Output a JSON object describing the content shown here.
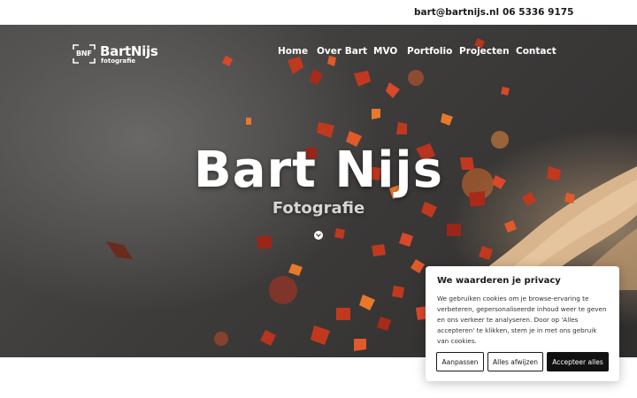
{
  "topbar": {
    "email": "bart@bartnijs.nl",
    "phone": "06 5336 9175"
  },
  "logo": {
    "mark_text": "BNF",
    "name": "BartNijs",
    "tagline": "fotografie"
  },
  "nav": {
    "items": [
      "Home",
      "Over Bart",
      "MVO",
      "Portfolio",
      "Projecten",
      "Contact"
    ]
  },
  "hero": {
    "title": "Bart Nijs",
    "subtitle": "Fotografie",
    "scroll_icon": "chevron-down-icon",
    "background": "chili-flakes-photo"
  },
  "cookie": {
    "title": "We waarderen je privacy",
    "text": "We gebruiken cookies om je browse-ervaring te verbeteren, gepersonaliseerde inhoud weer te geven en ons verkeer te analyseren. Door op 'Alles accepteren' te klikken, stem je in met ons gebruik van cookies.",
    "customize_label": "Aanpassen",
    "reject_label": "Alles afwijzen",
    "accept_label": "Accepteer alles"
  },
  "colors": {
    "accent_dark": "#111111",
    "flake_red": "#c0391f",
    "flake_orange": "#e8782a"
  }
}
